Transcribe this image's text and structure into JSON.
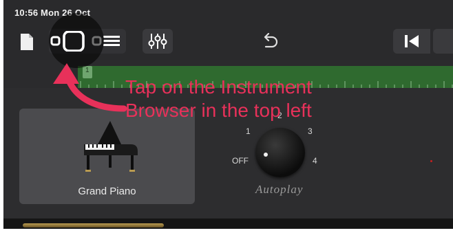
{
  "status_bar": {
    "time_date": "10:56  Mon 26 Oct"
  },
  "toolbar": {
    "my_songs_icon": "document-icon",
    "browser_icon": "instrument-browser-icon",
    "tracks_icon": "tracks-view-icon",
    "mixer_icon": "mixer-sliders-icon",
    "undo_icon": "undo-icon",
    "rewind_icon": "go-to-beginning-icon"
  },
  "timeline": {
    "region_marker": "1"
  },
  "instrument": {
    "name": "Grand Piano"
  },
  "autoplay": {
    "label": "Autoplay",
    "positions": {
      "off": "OFF",
      "p1": "1",
      "p2": "2",
      "p3": "3",
      "p4": "4"
    },
    "selected": "OFF"
  },
  "annotation": {
    "line1": "Tap on the Instrument",
    "line2": "Browser in the top left",
    "color": "#e8315a"
  },
  "colors": {
    "background": "#2b2b2d",
    "timeline": "#2f6a2f",
    "annotation": "#e8315a"
  }
}
